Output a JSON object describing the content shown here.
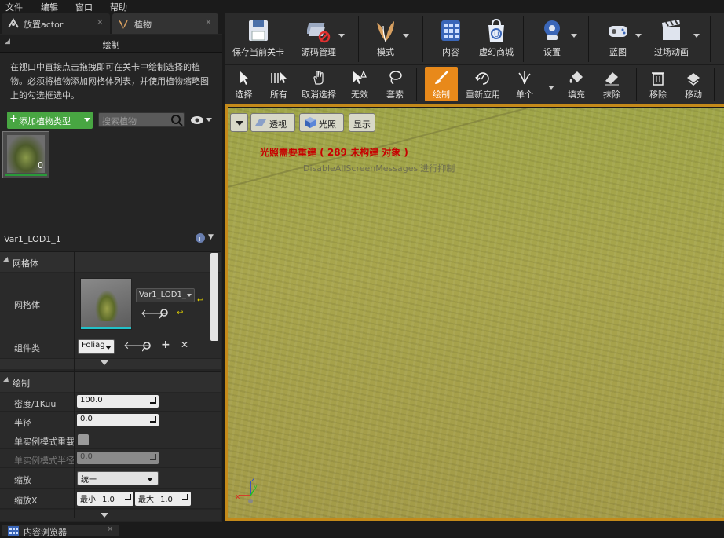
{
  "menu": [
    "文件",
    "编辑",
    "窗口",
    "帮助"
  ],
  "left_tabs": [
    {
      "label": "放置actor",
      "icon": "place-actor-icon"
    },
    {
      "label": "植物",
      "icon": "foliage-icon"
    }
  ],
  "paint_header": "绘制",
  "description": "在视口中直接点击拖拽即可在关卡中绘制选择的植物。必须将植物添加网格体列表，并使用植物缩略图上的勾选框选中。",
  "add_foliage_button": "添加植物类型",
  "search_placeholder": "搜索植物",
  "foliage_thumb_count": "0",
  "details_title": "Var1_LOD1_1",
  "mesh_section": {
    "title": "网格体",
    "mesh_label": "网格体",
    "mesh_value": "Var1_LOD1_",
    "component_label": "组件类",
    "component_value": "Foliag"
  },
  "paint_section": {
    "title": "绘制",
    "rows": [
      {
        "label": "密度/1Kuu",
        "value": "100.0"
      },
      {
        "label": "半径",
        "value": "0.0"
      },
      {
        "label": "单实例模式重载",
        "value": ""
      },
      {
        "label": "单实例模式半径",
        "value": "0.0"
      },
      {
        "label": "缩放",
        "value": "统一"
      }
    ],
    "scale_x_label": "缩放X",
    "scale_min_label": "最小",
    "scale_min": "1.0",
    "scale_max_label": "最大",
    "scale_max": "1.0"
  },
  "toolbar_main": [
    {
      "label": "保存当前关卡",
      "icon": "save-icon"
    },
    {
      "label": "源码管理",
      "icon": "source-control-icon"
    },
    {
      "label": "模式",
      "icon": "modes-icon"
    },
    {
      "label": "内容",
      "icon": "content-icon"
    },
    {
      "label": "虚幻商城",
      "icon": "marketplace-icon"
    },
    {
      "label": "设置",
      "icon": "settings-icon"
    },
    {
      "label": "蓝图",
      "icon": "blueprint-icon"
    },
    {
      "label": "过场动画",
      "icon": "cinematics-icon"
    }
  ],
  "toolbar_foliage": [
    {
      "label": "选择",
      "icon": "select-icon"
    },
    {
      "label": "所有",
      "icon": "select-all-icon"
    },
    {
      "label": "取消选择",
      "icon": "deselect-icon"
    },
    {
      "label": "无效",
      "icon": "invalid-icon"
    },
    {
      "label": "套索",
      "icon": "lasso-icon"
    },
    {
      "label": "绘制",
      "icon": "paint-icon"
    },
    {
      "label": "重新应用",
      "icon": "reapply-icon"
    },
    {
      "label": "单个",
      "icon": "single-icon"
    },
    {
      "label": "填充",
      "icon": "fill-icon"
    },
    {
      "label": "抹除",
      "icon": "erase-icon"
    },
    {
      "label": "移除",
      "icon": "remove-icon"
    },
    {
      "label": "移动",
      "icon": "move-icon"
    }
  ],
  "viewport": {
    "perspective": "透视",
    "lighting": "光照",
    "show": "显示",
    "warning": "光照需要重建 ( 289 未构建 对象 )",
    "hint": "'DisableAllScreenMessages'进行抑制"
  },
  "bottom_tab": "内容浏览器",
  "colors": {
    "accent": "#c48a1a",
    "add_button": "#48a642",
    "warning": "#c80000"
  }
}
